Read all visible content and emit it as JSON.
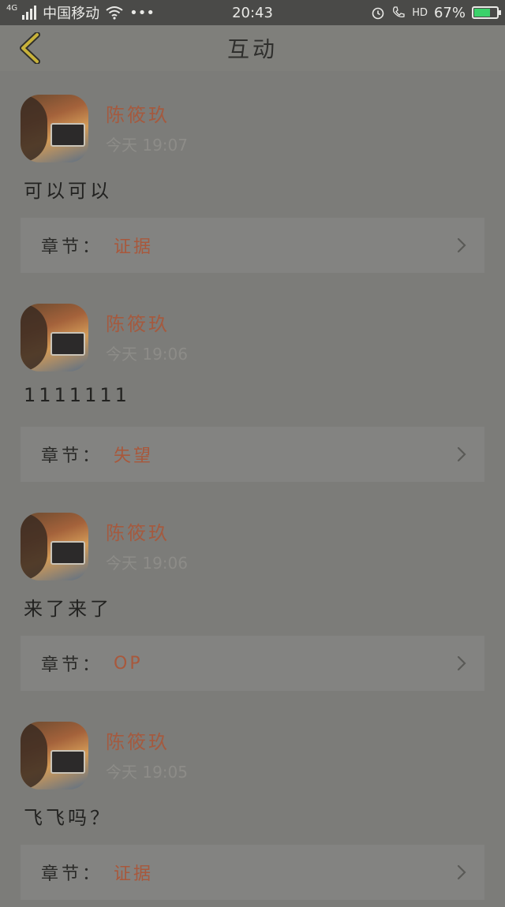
{
  "status_bar": {
    "network": "4G",
    "carrier": "中国移动",
    "more": "•••",
    "time": "20:43",
    "hd": "HD",
    "battery": "67%",
    "battery_level": 0.67
  },
  "header": {
    "back_icon": "chevron-left-icon",
    "title": "互动"
  },
  "posts": [
    {
      "user": "陈筱玖",
      "time": "今天 19:07",
      "content": "可以可以",
      "chapter_label": "章节：",
      "chapter": "证据"
    },
    {
      "user": "陈筱玖",
      "time": "今天 19:06",
      "content": "1111111",
      "chapter_label": "章节：",
      "chapter": "失望"
    },
    {
      "user": "陈筱玖",
      "time": "今天 19:06",
      "content": "来了来了",
      "chapter_label": "章节：",
      "chapter": "OP"
    },
    {
      "user": "陈筱玖",
      "time": "今天 19:05",
      "content": "飞飞吗？",
      "chapter_label": "章节：",
      "chapter": "证据"
    }
  ],
  "colors": {
    "overlay_bg": "#7c7c79",
    "status_bar": "#4a4a48",
    "username": "#a45a3f",
    "chapter_name": "#a8583c",
    "back_icon": "#c8b23a"
  }
}
